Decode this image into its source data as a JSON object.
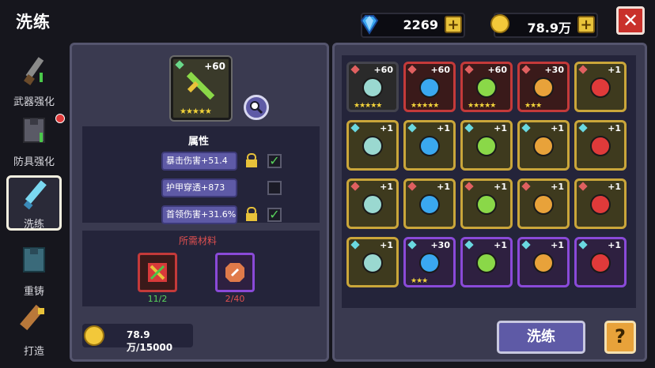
{
  "header": {
    "title": "洗练",
    "diamonds": "2269",
    "gold": "78.9万",
    "plus_label": "+",
    "close_label": "✕"
  },
  "sidebar": [
    {
      "label": "武器强化",
      "icon": "sword-upgrade-icon"
    },
    {
      "label": "防具强化",
      "icon": "armor-upgrade-icon"
    },
    {
      "label": "洗练",
      "icon": "refine-icon"
    },
    {
      "label": "重铸",
      "icon": "reforge-icon"
    },
    {
      "label": "打造",
      "icon": "forge-icon"
    }
  ],
  "selected": {
    "level": "+60",
    "stars": "★★★★★"
  },
  "attributes": {
    "title": "属性",
    "rows": [
      {
        "text": "暴击伤害+51.4",
        "locked": true,
        "checked": true
      },
      {
        "text": "护甲穿透+873",
        "locked": false,
        "checked": false
      },
      {
        "text": "首领伤害+31.6%",
        "locked": true,
        "checked": true
      }
    ]
  },
  "materials": {
    "title": "所需材料",
    "items": [
      {
        "count": "11/2",
        "count_color": "#58d35c"
      },
      {
        "count": "2/40",
        "count_color": "#e05050"
      }
    ]
  },
  "cost": {
    "value": "78.9万/15000"
  },
  "inventory": [
    {
      "level": "+60",
      "stars": "★★★★★",
      "frame": "dark"
    },
    {
      "level": "+60",
      "stars": "★★★★★",
      "frame": "red"
    },
    {
      "level": "+60",
      "stars": "★★★★★",
      "frame": "red"
    },
    {
      "level": "+30",
      "stars": "★★★",
      "frame": "red"
    },
    {
      "level": "+1",
      "stars": "",
      "frame": "gold"
    },
    {
      "level": "+1",
      "stars": "",
      "frame": "gold"
    },
    {
      "level": "+1",
      "stars": "",
      "frame": "gold"
    },
    {
      "level": "+1",
      "stars": "",
      "frame": "gold"
    },
    {
      "level": "+1",
      "stars": "",
      "frame": "gold"
    },
    {
      "level": "+1",
      "stars": "",
      "frame": "gold"
    },
    {
      "level": "+1",
      "stars": "",
      "frame": "gold"
    },
    {
      "level": "+1",
      "stars": "",
      "frame": "gold"
    },
    {
      "level": "+1",
      "stars": "",
      "frame": "gold"
    },
    {
      "level": "+1",
      "stars": "",
      "frame": "gold"
    },
    {
      "level": "+1",
      "stars": "",
      "frame": "gold"
    },
    {
      "level": "+1",
      "stars": "",
      "frame": "gold"
    },
    {
      "level": "+30",
      "stars": "★★★",
      "frame": "purple"
    },
    {
      "level": "+1",
      "stars": "",
      "frame": "purple"
    },
    {
      "level": "+1",
      "stars": "",
      "frame": "purple"
    },
    {
      "level": "+1",
      "stars": "",
      "frame": "purple"
    }
  ],
  "buttons": {
    "refine": "洗练",
    "help": "?"
  }
}
